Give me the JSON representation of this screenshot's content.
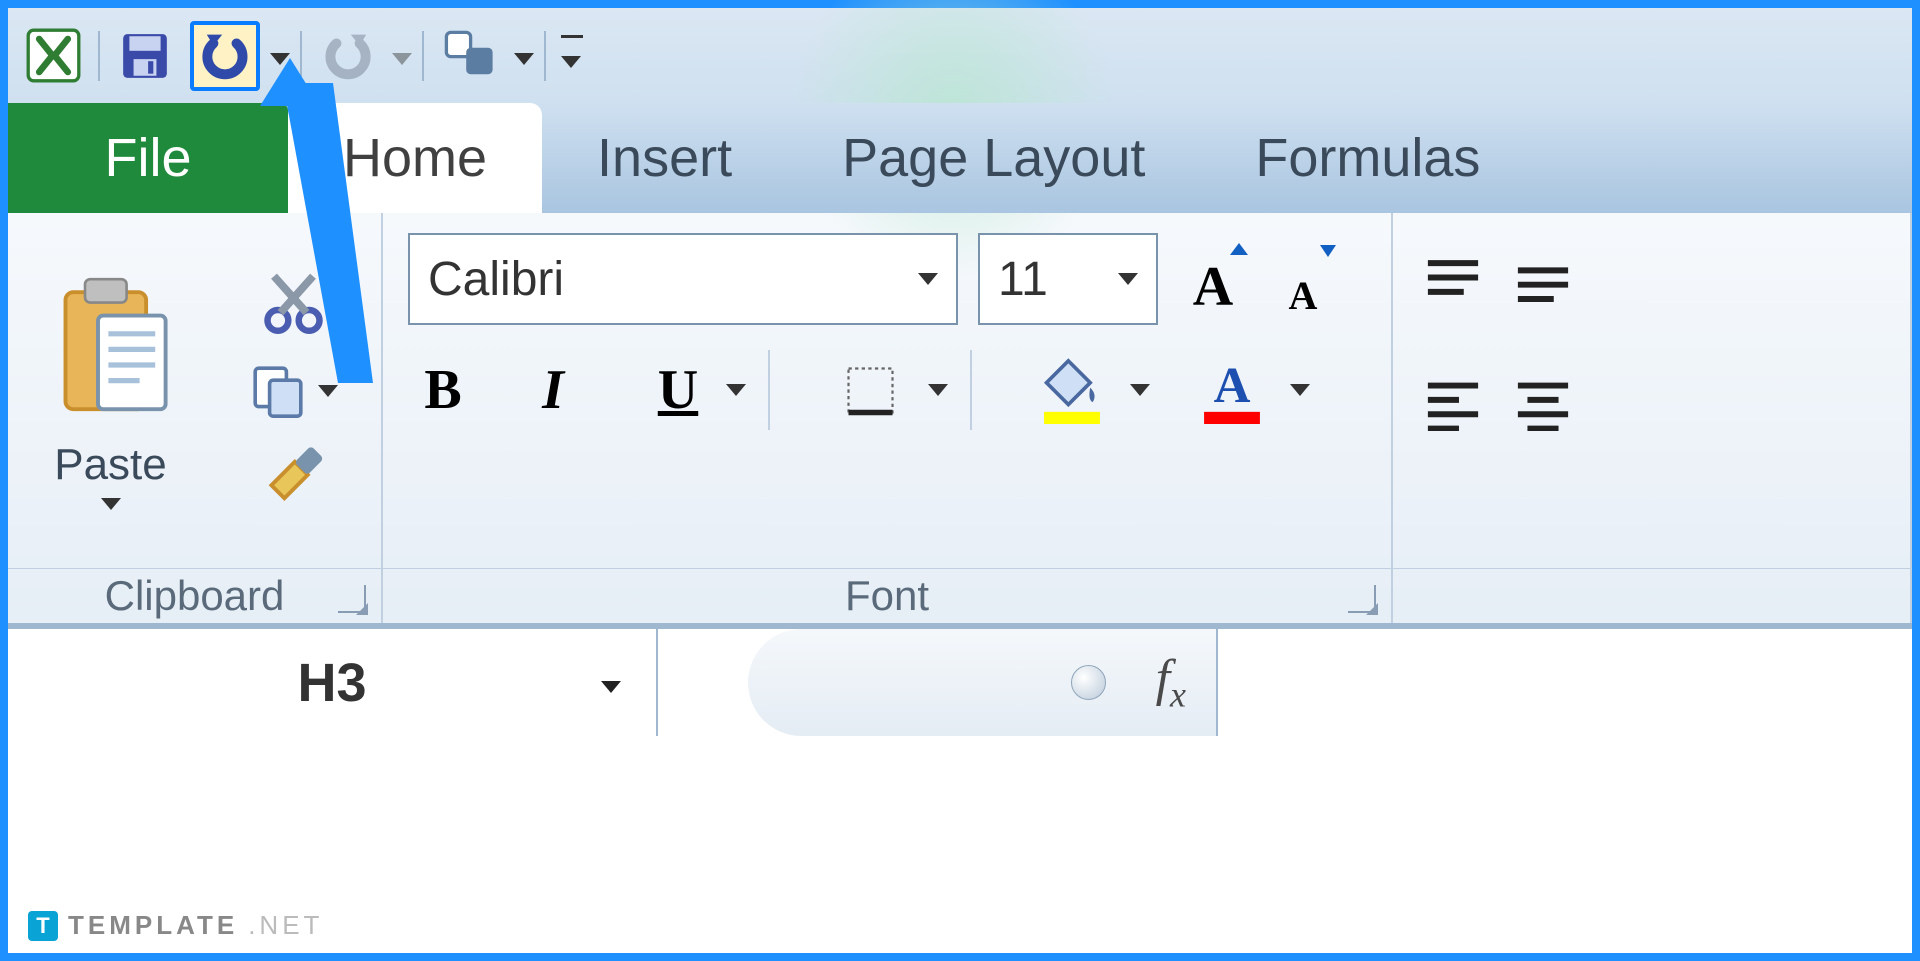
{
  "qat": {
    "undo_highlighted": true
  },
  "tabs": {
    "file": "File",
    "home": "Home",
    "insert": "Insert",
    "page_layout": "Page Layout",
    "formulas": "Formulas"
  },
  "ribbon": {
    "clipboard": {
      "paste": "Paste",
      "label": "Clipboard"
    },
    "font": {
      "name": "Calibri",
      "size": "11",
      "label": "Font",
      "fill_color": "#ffff00",
      "font_color": "#ff0000"
    }
  },
  "formula_bar": {
    "cell_ref": "H3",
    "formula": ""
  },
  "watermark": {
    "brand": "TEMPLATE",
    "suffix": ".NET",
    "badge": "T"
  }
}
